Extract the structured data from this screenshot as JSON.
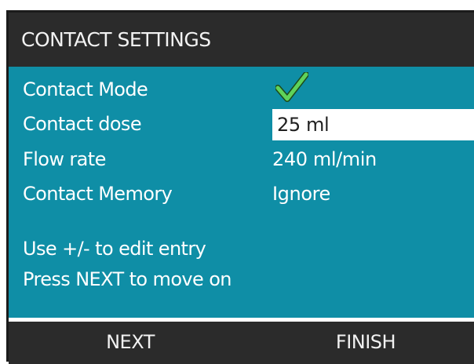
{
  "title": "CONTACT SETTINGS",
  "settings": [
    {
      "label": "Contact Mode",
      "value": "",
      "icon": "checkmark-icon"
    },
    {
      "label": "Contact dose",
      "value": "25 ml"
    },
    {
      "label": "Flow rate",
      "value": "240 ml/min"
    },
    {
      "label": "Contact Memory",
      "value": "Ignore"
    }
  ],
  "help": {
    "line1": "Use +/- to edit entry",
    "line2": "Press NEXT to move on"
  },
  "softkeys": {
    "next": "NEXT",
    "finish": "FINISH"
  },
  "colors": {
    "background": "#0f8ea6",
    "bars": "#2b2b2b",
    "check": "#5fd35a"
  }
}
